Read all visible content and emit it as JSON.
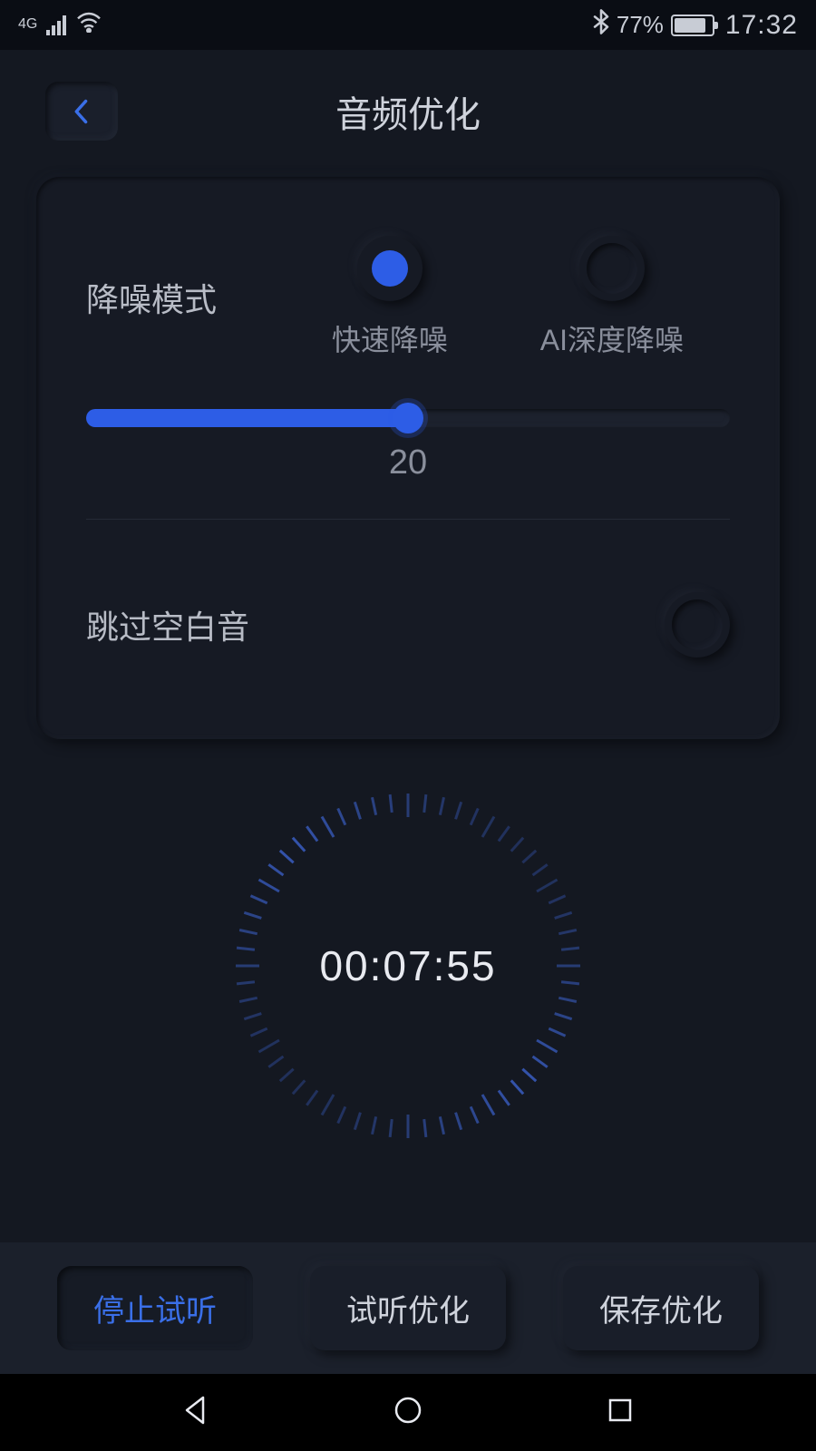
{
  "status": {
    "network": "4G",
    "battery": "77%",
    "time": "17:32"
  },
  "header": {
    "title": "音频优化"
  },
  "noise": {
    "label": "降噪模式",
    "options": [
      {
        "label": "快速降噪",
        "selected": true
      },
      {
        "label": "AI深度降噪",
        "selected": false
      }
    ],
    "slider_value": "20",
    "slider_pct": 50
  },
  "skip": {
    "label": "跳过空白音",
    "on": false
  },
  "timer": {
    "text": "00:07:55"
  },
  "actions": {
    "stop": "停止试听",
    "preview": "试听优化",
    "save": "保存优化"
  }
}
